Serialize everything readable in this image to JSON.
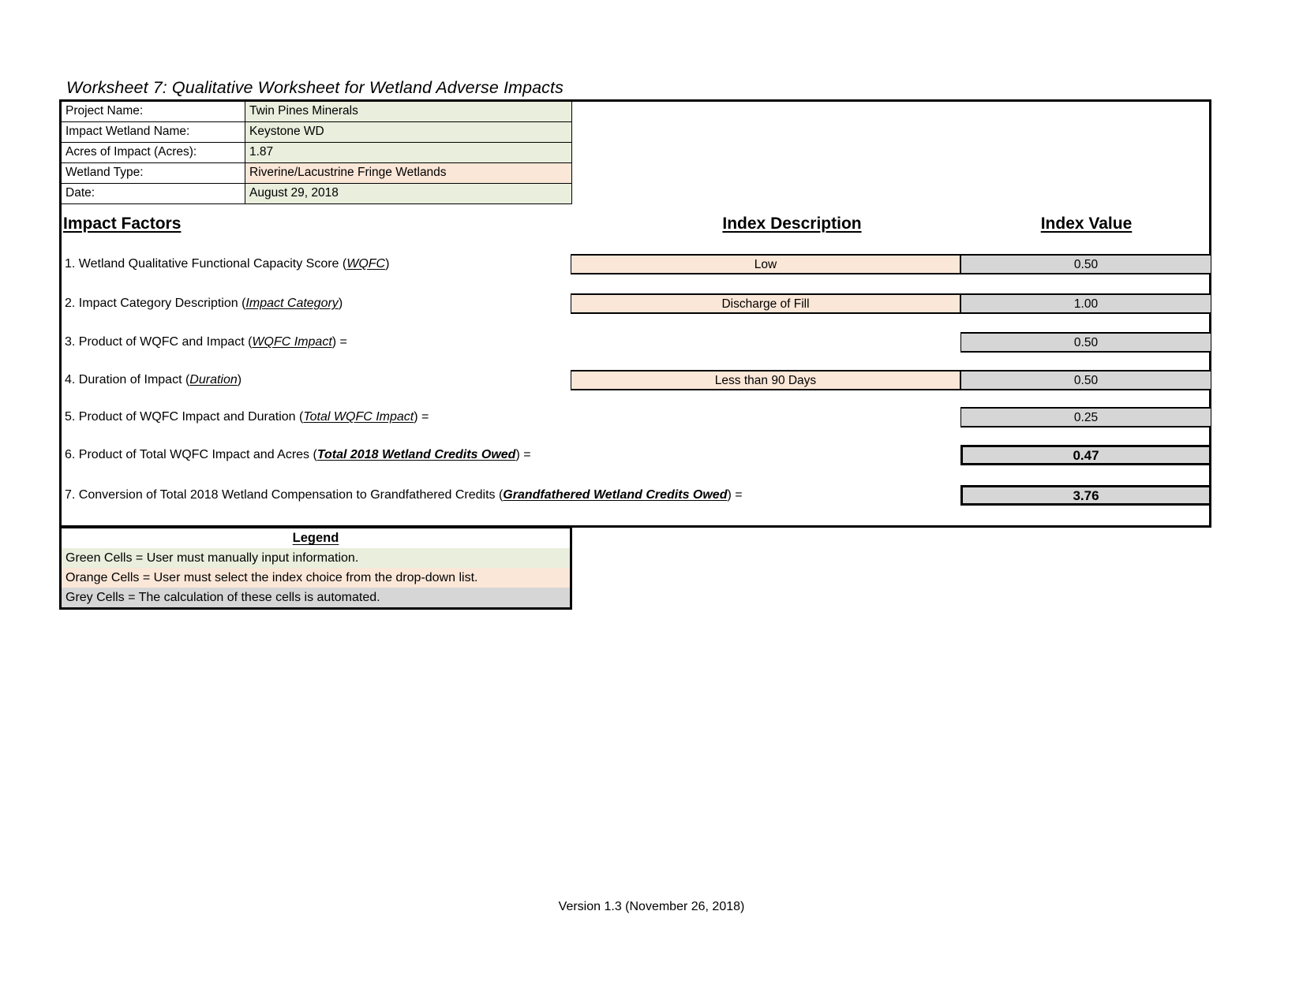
{
  "title": "Worksheet 7:  Qualitative Worksheet for Wetland Adverse Impacts",
  "info": {
    "rows": [
      {
        "label": "Project Name:",
        "value": "Twin Pines Minerals",
        "cell_type": "green"
      },
      {
        "label": "Impact Wetland Name:",
        "value": "Keystone WD",
        "cell_type": "green"
      },
      {
        "label": "Acres of Impact (Acres):",
        "value": "1.87",
        "cell_type": "green"
      },
      {
        "label": "Wetland Type:",
        "value": "Riverine/Lacustrine Fringe Wetlands",
        "cell_type": "orange"
      },
      {
        "label": "Date:",
        "value": "August 29, 2018",
        "cell_type": "green"
      }
    ]
  },
  "headings": {
    "impact_factors": "Impact Factors",
    "index_description": "Index Description",
    "index_value": "Index Value"
  },
  "factors": [
    {
      "number": "1.",
      "text_before": "1. Wetland Qualitative Functional Capacity Score (",
      "emphasis": "WQFC",
      "text_after": ")",
      "description": "Low",
      "value": "0.50",
      "bold_value": false
    },
    {
      "number": "2.",
      "text_before": "2. Impact Category Description (",
      "emphasis": "Impact Category",
      "text_after": ")",
      "description": "Discharge of Fill",
      "value": "1.00",
      "bold_value": false
    },
    {
      "number": "3.",
      "text_before": "3. Product of WQFC and Impact (",
      "emphasis": "WQFC Impact",
      "text_after": ") =",
      "description": "",
      "value": "0.50",
      "bold_value": false
    },
    {
      "number": "4.",
      "text_before": "4. Duration of Impact (",
      "emphasis": "Duration",
      "text_after": ")",
      "description": "Less than 90 Days",
      "value": "0.50",
      "bold_value": false
    },
    {
      "number": "5.",
      "text_before": "5. Product of WQFC Impact and Duration (",
      "emphasis": "Total WQFC Impact",
      "text_after": ") =",
      "description": "",
      "value": "0.25",
      "bold_value": false
    },
    {
      "number": "6.",
      "text_before": "6. Product of Total WQFC Impact and Acres (",
      "emphasis": "Total 2018 Wetland Credits Owed",
      "text_after": ") =",
      "description": "",
      "value": "0.47",
      "bold_value": true
    },
    {
      "number": "7.",
      "text_before": "7. Conversion of Total 2018 Wetland Compensation to Grandfathered Credits (",
      "emphasis": "Grandfathered Wetland Credits Owed",
      "text_after": ") =",
      "description": "",
      "value": "3.76",
      "bold_value": true
    }
  ],
  "legend": {
    "title": "Legend",
    "lines": [
      {
        "text": "Green Cells = User must manually input information.",
        "cell_type": "green"
      },
      {
        "text": "Orange Cells = User must select the index choice from the drop-down list.",
        "cell_type": "orange"
      },
      {
        "text": "Grey Cells = The calculation of these cells is automated.",
        "cell_type": "grey"
      }
    ]
  },
  "footer": {
    "version": "Version 1.3 (November 26, 2018)"
  },
  "colors": {
    "green_cell": "#e9eedd",
    "orange_cell": "#fbe7d8",
    "grey_cell": "#d6d6d6",
    "border": "#000000"
  }
}
